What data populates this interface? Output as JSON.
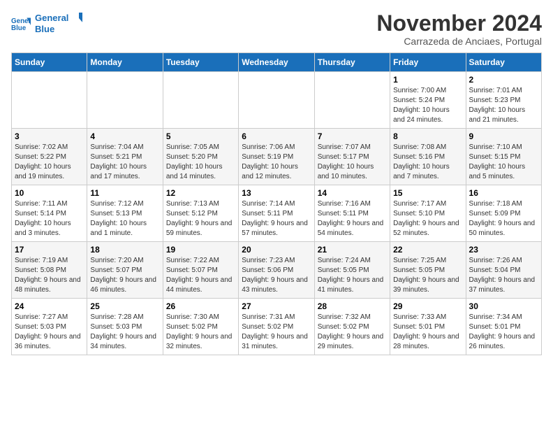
{
  "logo": {
    "line1": "General",
    "line2": "Blue"
  },
  "title": "November 2024",
  "location": "Carrazeda de Anciaes, Portugal",
  "weekdays": [
    "Sunday",
    "Monday",
    "Tuesday",
    "Wednesday",
    "Thursday",
    "Friday",
    "Saturday"
  ],
  "weeks": [
    [
      {
        "day": "",
        "info": ""
      },
      {
        "day": "",
        "info": ""
      },
      {
        "day": "",
        "info": ""
      },
      {
        "day": "",
        "info": ""
      },
      {
        "day": "",
        "info": ""
      },
      {
        "day": "1",
        "info": "Sunrise: 7:00 AM\nSunset: 5:24 PM\nDaylight: 10 hours and 24 minutes."
      },
      {
        "day": "2",
        "info": "Sunrise: 7:01 AM\nSunset: 5:23 PM\nDaylight: 10 hours and 21 minutes."
      }
    ],
    [
      {
        "day": "3",
        "info": "Sunrise: 7:02 AM\nSunset: 5:22 PM\nDaylight: 10 hours and 19 minutes."
      },
      {
        "day": "4",
        "info": "Sunrise: 7:04 AM\nSunset: 5:21 PM\nDaylight: 10 hours and 17 minutes."
      },
      {
        "day": "5",
        "info": "Sunrise: 7:05 AM\nSunset: 5:20 PM\nDaylight: 10 hours and 14 minutes."
      },
      {
        "day": "6",
        "info": "Sunrise: 7:06 AM\nSunset: 5:19 PM\nDaylight: 10 hours and 12 minutes."
      },
      {
        "day": "7",
        "info": "Sunrise: 7:07 AM\nSunset: 5:17 PM\nDaylight: 10 hours and 10 minutes."
      },
      {
        "day": "8",
        "info": "Sunrise: 7:08 AM\nSunset: 5:16 PM\nDaylight: 10 hours and 7 minutes."
      },
      {
        "day": "9",
        "info": "Sunrise: 7:10 AM\nSunset: 5:15 PM\nDaylight: 10 hours and 5 minutes."
      }
    ],
    [
      {
        "day": "10",
        "info": "Sunrise: 7:11 AM\nSunset: 5:14 PM\nDaylight: 10 hours and 3 minutes."
      },
      {
        "day": "11",
        "info": "Sunrise: 7:12 AM\nSunset: 5:13 PM\nDaylight: 10 hours and 1 minute."
      },
      {
        "day": "12",
        "info": "Sunrise: 7:13 AM\nSunset: 5:12 PM\nDaylight: 9 hours and 59 minutes."
      },
      {
        "day": "13",
        "info": "Sunrise: 7:14 AM\nSunset: 5:11 PM\nDaylight: 9 hours and 57 minutes."
      },
      {
        "day": "14",
        "info": "Sunrise: 7:16 AM\nSunset: 5:11 PM\nDaylight: 9 hours and 54 minutes."
      },
      {
        "day": "15",
        "info": "Sunrise: 7:17 AM\nSunset: 5:10 PM\nDaylight: 9 hours and 52 minutes."
      },
      {
        "day": "16",
        "info": "Sunrise: 7:18 AM\nSunset: 5:09 PM\nDaylight: 9 hours and 50 minutes."
      }
    ],
    [
      {
        "day": "17",
        "info": "Sunrise: 7:19 AM\nSunset: 5:08 PM\nDaylight: 9 hours and 48 minutes."
      },
      {
        "day": "18",
        "info": "Sunrise: 7:20 AM\nSunset: 5:07 PM\nDaylight: 9 hours and 46 minutes."
      },
      {
        "day": "19",
        "info": "Sunrise: 7:22 AM\nSunset: 5:07 PM\nDaylight: 9 hours and 44 minutes."
      },
      {
        "day": "20",
        "info": "Sunrise: 7:23 AM\nSunset: 5:06 PM\nDaylight: 9 hours and 43 minutes."
      },
      {
        "day": "21",
        "info": "Sunrise: 7:24 AM\nSunset: 5:05 PM\nDaylight: 9 hours and 41 minutes."
      },
      {
        "day": "22",
        "info": "Sunrise: 7:25 AM\nSunset: 5:05 PM\nDaylight: 9 hours and 39 minutes."
      },
      {
        "day": "23",
        "info": "Sunrise: 7:26 AM\nSunset: 5:04 PM\nDaylight: 9 hours and 37 minutes."
      }
    ],
    [
      {
        "day": "24",
        "info": "Sunrise: 7:27 AM\nSunset: 5:03 PM\nDaylight: 9 hours and 36 minutes."
      },
      {
        "day": "25",
        "info": "Sunrise: 7:28 AM\nSunset: 5:03 PM\nDaylight: 9 hours and 34 minutes."
      },
      {
        "day": "26",
        "info": "Sunrise: 7:30 AM\nSunset: 5:02 PM\nDaylight: 9 hours and 32 minutes."
      },
      {
        "day": "27",
        "info": "Sunrise: 7:31 AM\nSunset: 5:02 PM\nDaylight: 9 hours and 31 minutes."
      },
      {
        "day": "28",
        "info": "Sunrise: 7:32 AM\nSunset: 5:02 PM\nDaylight: 9 hours and 29 minutes."
      },
      {
        "day": "29",
        "info": "Sunrise: 7:33 AM\nSunset: 5:01 PM\nDaylight: 9 hours and 28 minutes."
      },
      {
        "day": "30",
        "info": "Sunrise: 7:34 AM\nSunset: 5:01 PM\nDaylight: 9 hours and 26 minutes."
      }
    ]
  ]
}
